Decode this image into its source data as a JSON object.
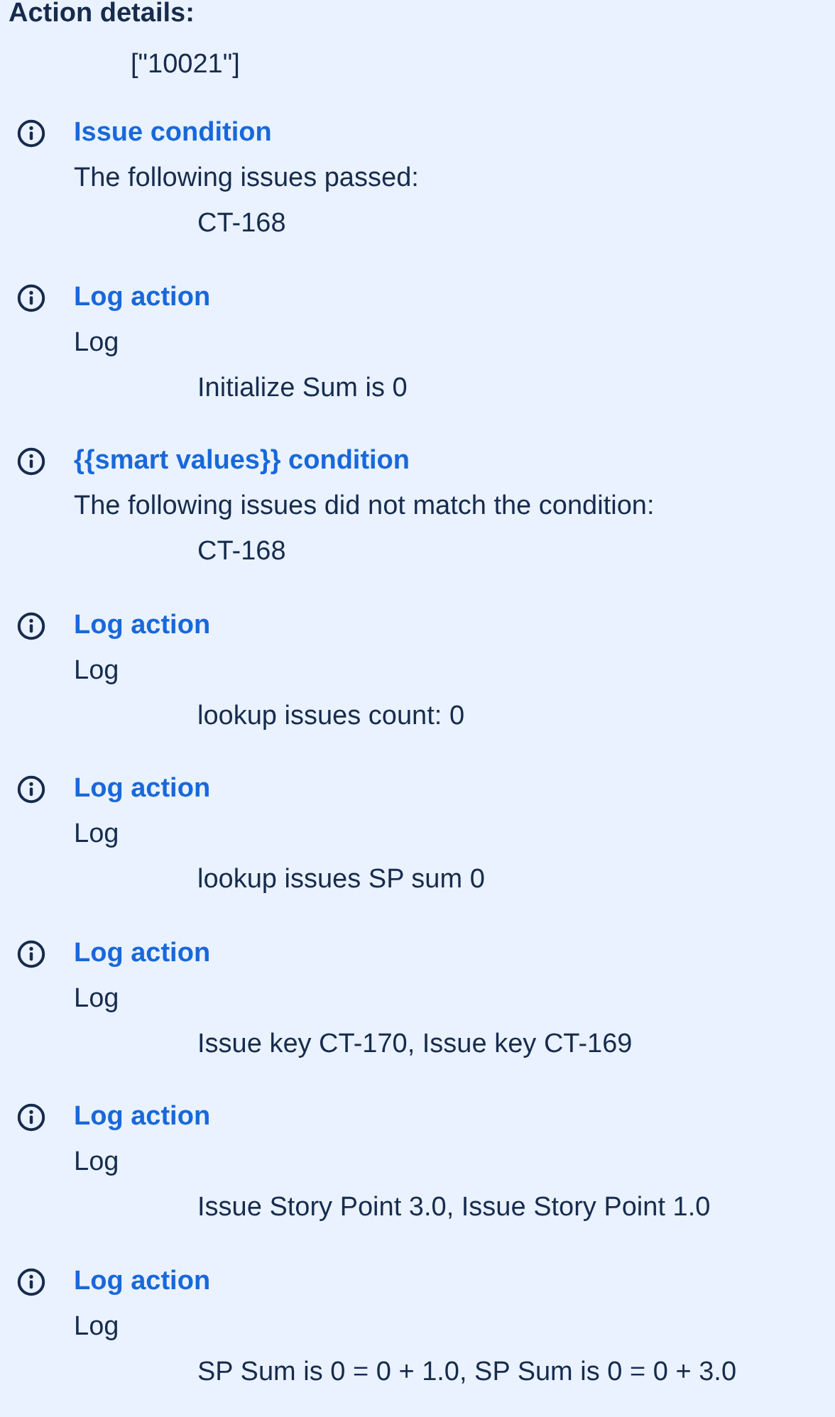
{
  "header": {
    "title": "Action details:",
    "value": "[\"10021\"]"
  },
  "entries": [
    {
      "title": "Issue condition",
      "description": "The following issues passed:",
      "detail": "CT-168"
    },
    {
      "title": "Log action",
      "description": "Log",
      "detail": "Initialize Sum is 0"
    },
    {
      "title": "{{smart values}} condition",
      "description": "The following issues did not match the condition:",
      "detail": "CT-168"
    },
    {
      "title": "Log action",
      "description": "Log",
      "detail": "lookup issues count: 0"
    },
    {
      "title": "Log action",
      "description": "Log",
      "detail": "lookup issues SP sum 0"
    },
    {
      "title": "Log action",
      "description": "Log",
      "detail": "Issue key CT-170, Issue key CT-169"
    },
    {
      "title": "Log action",
      "description": "Log",
      "detail": "Issue Story Point 3.0, Issue Story Point 1.0"
    },
    {
      "title": "Log action",
      "description": "Log",
      "detail": "SP Sum is 0 = 0 + 1.0, SP Sum is 0 = 0 + 3.0"
    }
  ]
}
